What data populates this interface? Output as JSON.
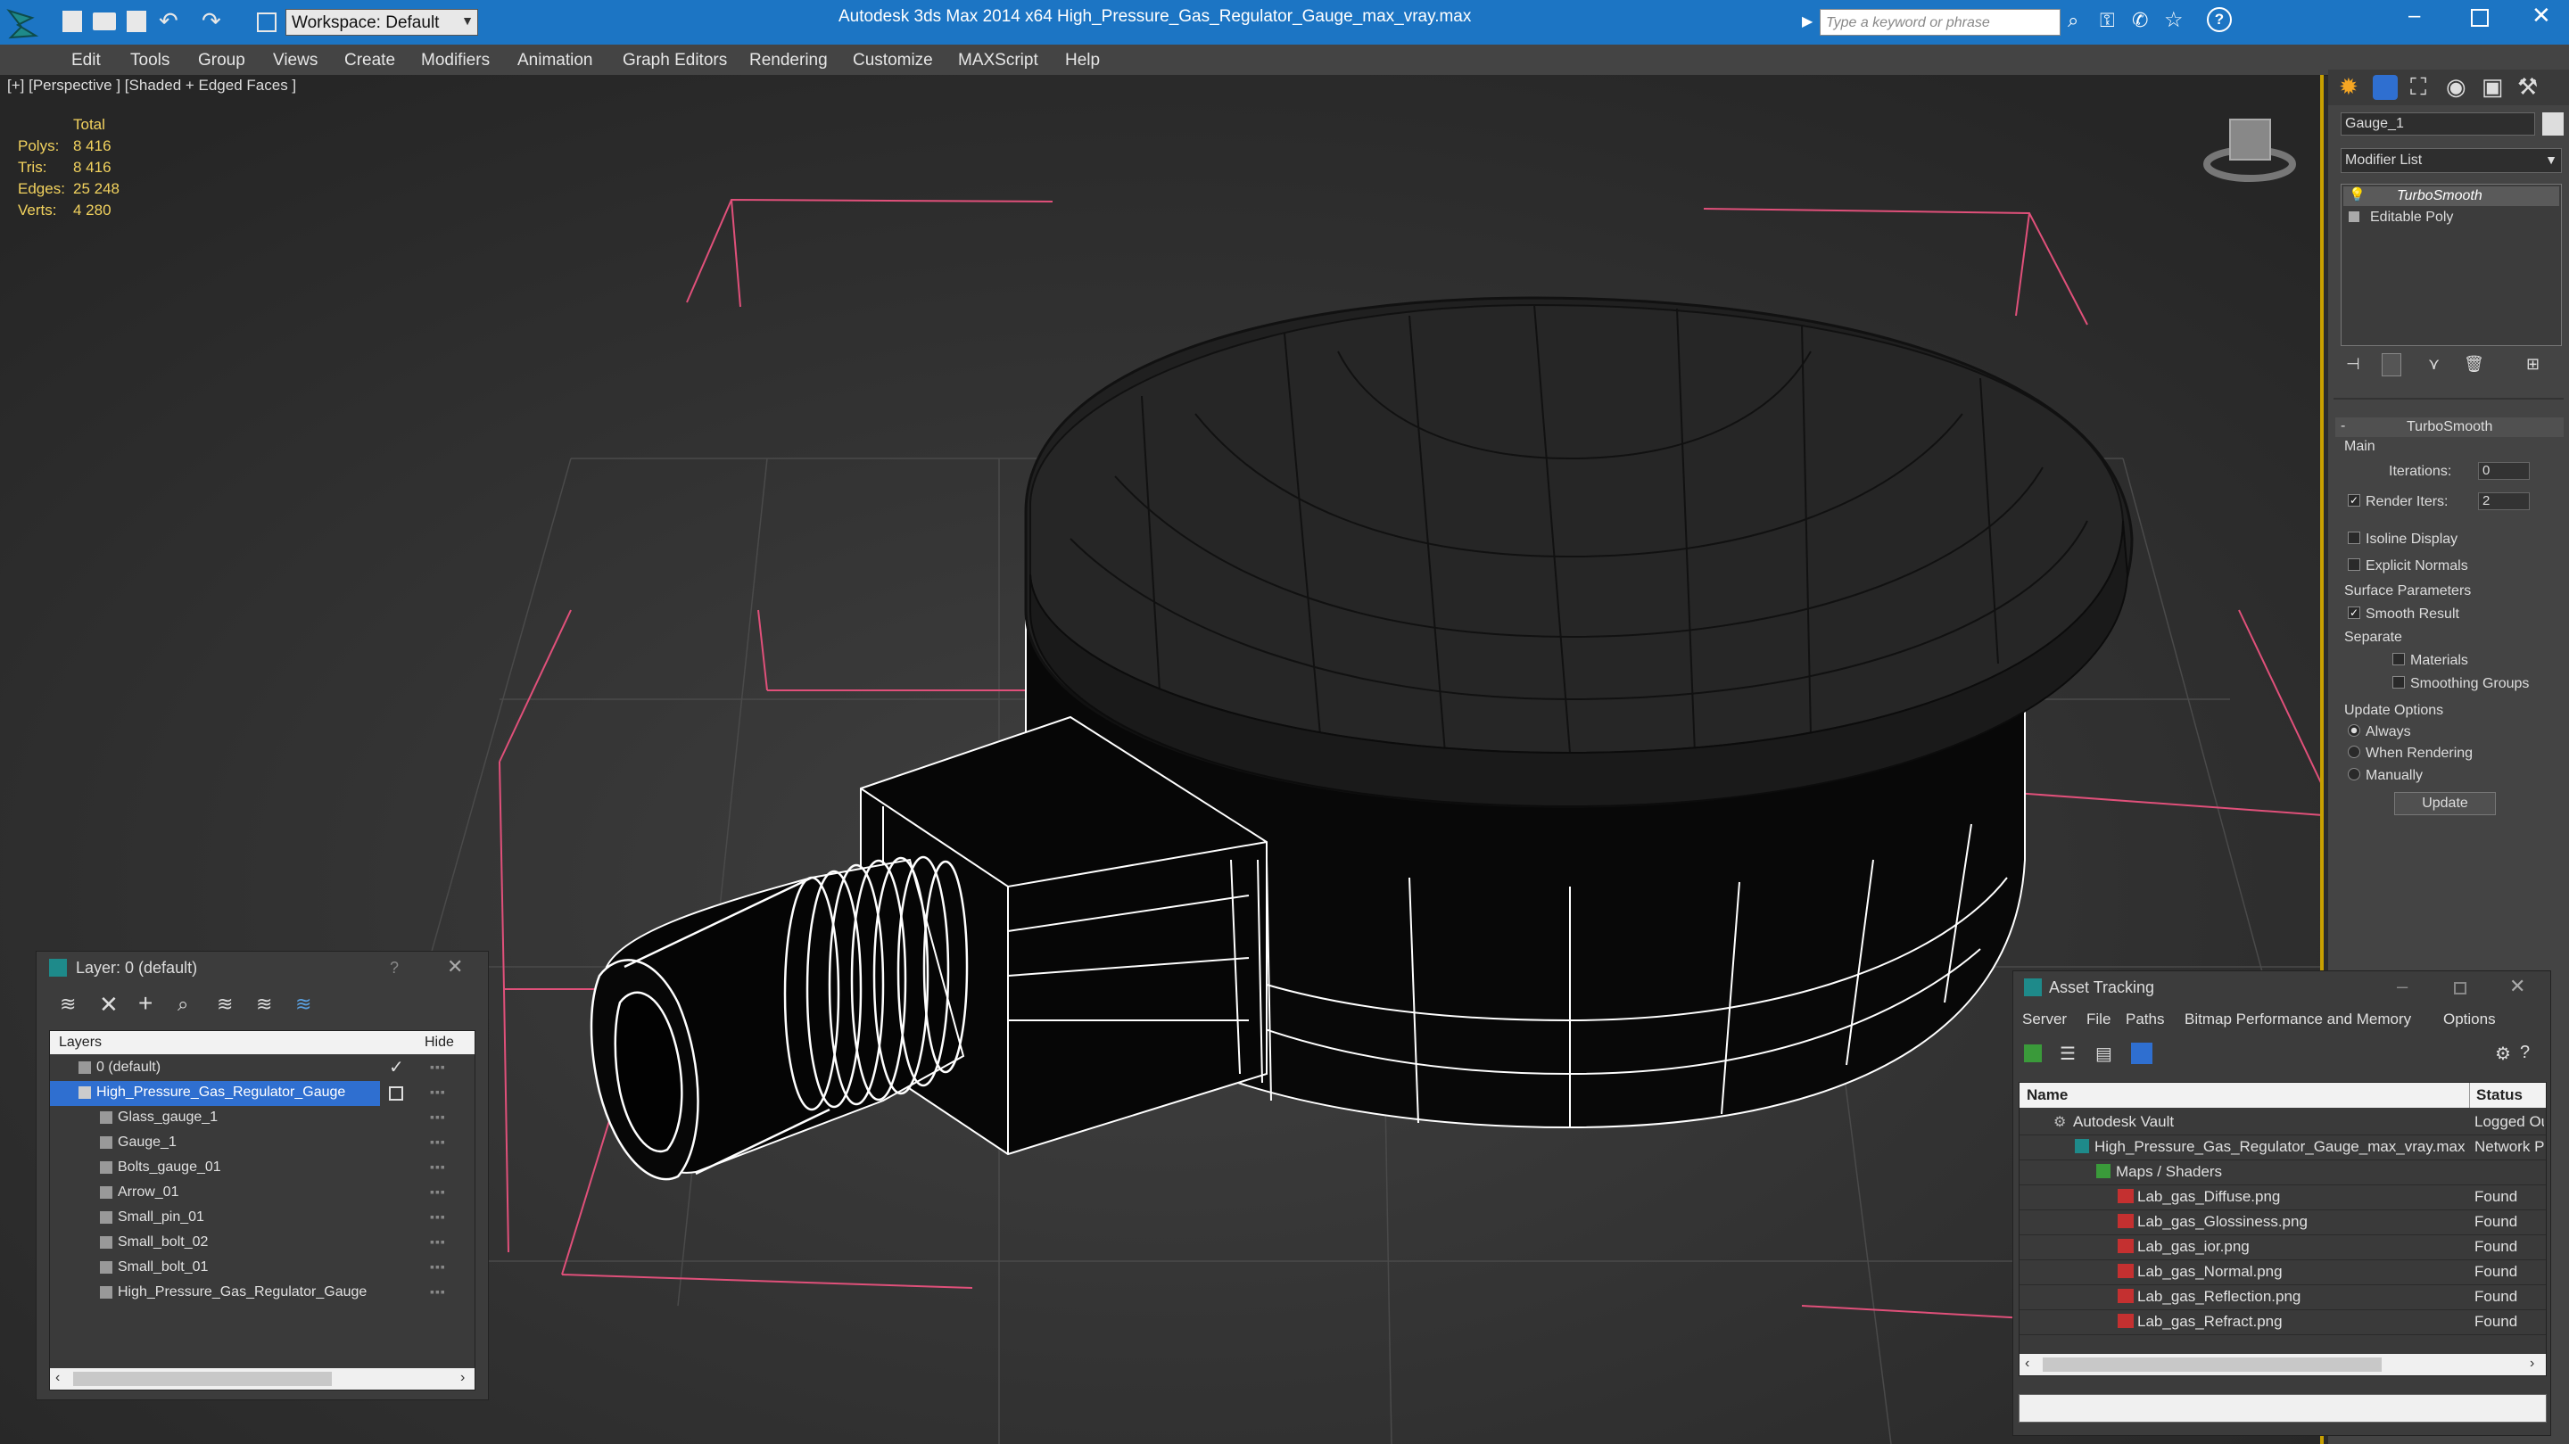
{
  "app": {
    "title_text": "Autodesk 3ds Max  2014 x64      High_Pressure_Gas_Regulator_Gauge_max_vray.max",
    "workspace_label": "Workspace: Default",
    "search_placeholder": "Type a keyword or phrase"
  },
  "menu": [
    "Edit",
    "Tools",
    "Group",
    "Views",
    "Create",
    "Modifiers",
    "Animation",
    "Graph Editors",
    "Rendering",
    "Customize",
    "MAXScript",
    "Help"
  ],
  "viewport": {
    "label": "[+] [Perspective ] [Shaded + Edged Faces ]",
    "stats": {
      "header": "Total",
      "polys_label": "Polys:",
      "polys": "8 416",
      "tris_label": "Tris:",
      "tris": "8 416",
      "edges_label": "Edges:",
      "edges": "25 248",
      "verts_label": "Verts:",
      "verts": "4 280"
    }
  },
  "command_panel": {
    "object_name": "Gauge_1",
    "modifier_list": "Modifier List",
    "stack": [
      "TurboSmooth",
      "Editable Poly"
    ],
    "rollout_title": "TurboSmooth",
    "main_group": "Main",
    "iterations_label": "Iterations:",
    "iterations_value": "0",
    "render_iters_label": "Render Iters:",
    "render_iters_value": "2",
    "isoline_label": "Isoline Display",
    "explicit_normals_label": "Explicit Normals",
    "surface_group": "Surface Parameters",
    "smooth_result_label": "Smooth Result",
    "separate_label": "Separate",
    "materials_label": "Materials",
    "smoothing_groups_label": "Smoothing Groups",
    "update_group": "Update Options",
    "always_label": "Always",
    "when_rendering_label": "When Rendering",
    "manually_label": "Manually",
    "update_button": "Update"
  },
  "layer_dialog": {
    "title": "Layer: 0 (default)",
    "help": "?",
    "col_layers": "Layers",
    "col_hide": "Hide",
    "rows": [
      {
        "name": "0 (default)",
        "indent": 0
      },
      {
        "name": "High_Pressure_Gas_Regulator_Gauge",
        "indent": 0
      },
      {
        "name": "Glass_gauge_1",
        "indent": 1
      },
      {
        "name": "Gauge_1",
        "indent": 1
      },
      {
        "name": "Bolts_gauge_01",
        "indent": 1
      },
      {
        "name": "Arrow_01",
        "indent": 1
      },
      {
        "name": "Small_pin_01",
        "indent": 1
      },
      {
        "name": "Small_bolt_02",
        "indent": 1
      },
      {
        "name": "Small_bolt_01",
        "indent": 1
      },
      {
        "name": "High_Pressure_Gas_Regulator_Gauge",
        "indent": 1
      }
    ]
  },
  "asset_dialog": {
    "title": "Asset Tracking",
    "menu": [
      "Server",
      "File",
      "Paths",
      "Bitmap Performance and Memory",
      "Options"
    ],
    "col_name": "Name",
    "col_status": "Status",
    "rows": [
      {
        "name": "Autodesk Vault",
        "status": "Logged Ou"
      },
      {
        "name": "High_Pressure_Gas_Regulator_Gauge_max_vray.max",
        "status": "Network P"
      },
      {
        "name": "Maps / Shaders",
        "status": ""
      },
      {
        "name": "Lab_gas_Diffuse.png",
        "status": "Found"
      },
      {
        "name": "Lab_gas_Glossiness.png",
        "status": "Found"
      },
      {
        "name": "Lab_gas_ior.png",
        "status": "Found"
      },
      {
        "name": "Lab_gas_Normal.png",
        "status": "Found"
      },
      {
        "name": "Lab_gas_Reflection.png",
        "status": "Found"
      },
      {
        "name": "Lab_gas_Refract.png",
        "status": "Found"
      }
    ]
  },
  "colors": {
    "title_blue": "#1c75c4",
    "selection_blue": "#2f6fd0",
    "viewport_border": "#c8a000",
    "stat_yellow": "#f2d25e",
    "grid_pink": "#e0507a"
  }
}
